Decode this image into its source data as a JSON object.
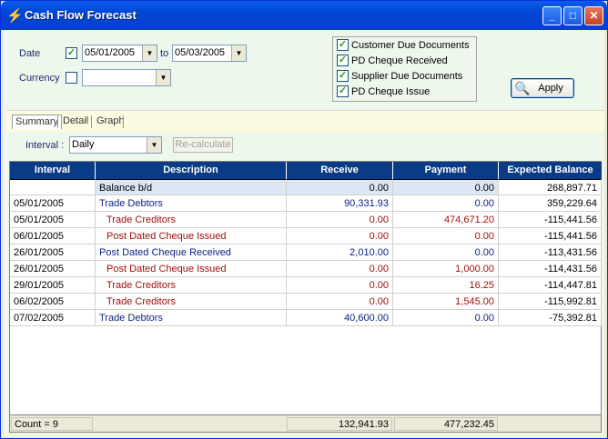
{
  "window": {
    "title": "Cash Flow Forecast",
    "icon": "lightning-icon"
  },
  "filters": {
    "date_label": "Date",
    "date_checked": true,
    "date_from": "05/01/2005",
    "to_label": "to",
    "date_to": "05/03/2005",
    "currency_label": "Currency",
    "currency_checked": false,
    "currency_value": ""
  },
  "options": [
    {
      "label": "Customer Due Documents",
      "checked": true
    },
    {
      "label": "PD Cheque Received",
      "checked": true
    },
    {
      "label": "Supplier Due Documents",
      "checked": true
    },
    {
      "label": "PD Cheque Issue",
      "checked": true
    }
  ],
  "apply_label": "Apply",
  "tabs": [
    {
      "label": "Summary",
      "active": true
    },
    {
      "label": "Detail",
      "active": false
    },
    {
      "label": "Graph",
      "active": false
    }
  ],
  "interval": {
    "label": "Interval :",
    "value": "Daily",
    "recalc_label": "Re-calculate"
  },
  "table": {
    "columns": [
      "Interval",
      "Description",
      "Receive",
      "Payment",
      "Expected Balance"
    ],
    "rows": [
      {
        "interval": "",
        "description": "Balance b/d",
        "receive": "0.00",
        "payment": "0.00",
        "balance": "268,897.71",
        "style": "bal"
      },
      {
        "interval": "05/01/2005",
        "description": "Trade Debtors",
        "receive": "90,331.93",
        "payment": "0.00",
        "balance": "359,229.64",
        "style": "in"
      },
      {
        "interval": "05/01/2005",
        "description": "Trade Creditors",
        "receive": "0.00",
        "payment": "474,671.20",
        "balance": "-115,441.56",
        "style": "out"
      },
      {
        "interval": "06/01/2005",
        "description": "Post Dated Cheque Issued",
        "receive": "0.00",
        "payment": "0.00",
        "balance": "-115,441.56",
        "style": "out"
      },
      {
        "interval": "26/01/2005",
        "description": "Post Dated Cheque Received",
        "receive": "2,010.00",
        "payment": "0.00",
        "balance": "-113,431.56",
        "style": "in"
      },
      {
        "interval": "26/01/2005",
        "description": "Post Dated Cheque Issued",
        "receive": "0.00",
        "payment": "1,000.00",
        "balance": "-114,431.56",
        "style": "out"
      },
      {
        "interval": "29/01/2005",
        "description": "Trade Creditors",
        "receive": "0.00",
        "payment": "16.25",
        "balance": "-114,447.81",
        "style": "out"
      },
      {
        "interval": "06/02/2005",
        "description": "Trade Creditors",
        "receive": "0.00",
        "payment": "1,545.00",
        "balance": "-115,992.81",
        "style": "out"
      },
      {
        "interval": "07/02/2005",
        "description": "Trade Debtors",
        "receive": "40,600.00",
        "payment": "0.00",
        "balance": "-75,392.81",
        "style": "in"
      }
    ],
    "footer": {
      "count": "Count = 9",
      "receive_total": "132,941.93",
      "payment_total": "477,232.45"
    }
  }
}
